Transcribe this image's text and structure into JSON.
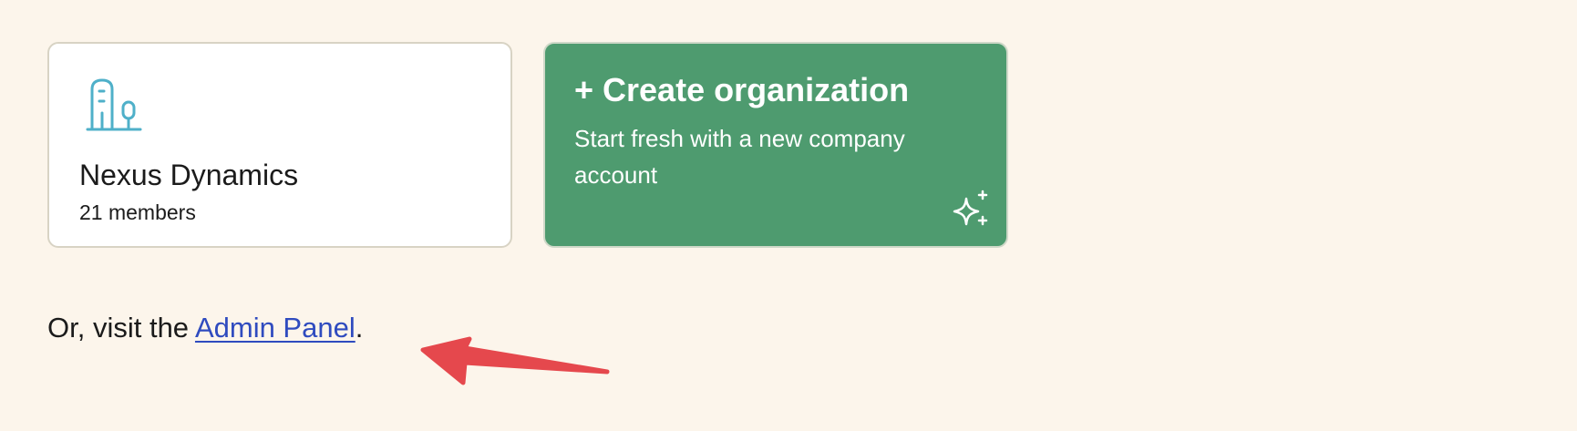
{
  "organization_card": {
    "name": "Nexus Dynamics",
    "members": "21 members",
    "icon": "building-icon",
    "icon_color": "#4fb0c9"
  },
  "create_card": {
    "title": "+ Create organization",
    "description": "Start fresh with a new company account",
    "icon": "sparkles-icon",
    "background_color": "#4e9b6f"
  },
  "visit": {
    "prefix": "Or, visit the ",
    "link_label": "Admin Panel",
    "suffix": ".",
    "link_color": "#2f4bbf"
  },
  "annotation": {
    "type": "arrow",
    "color": "#e5484d"
  }
}
